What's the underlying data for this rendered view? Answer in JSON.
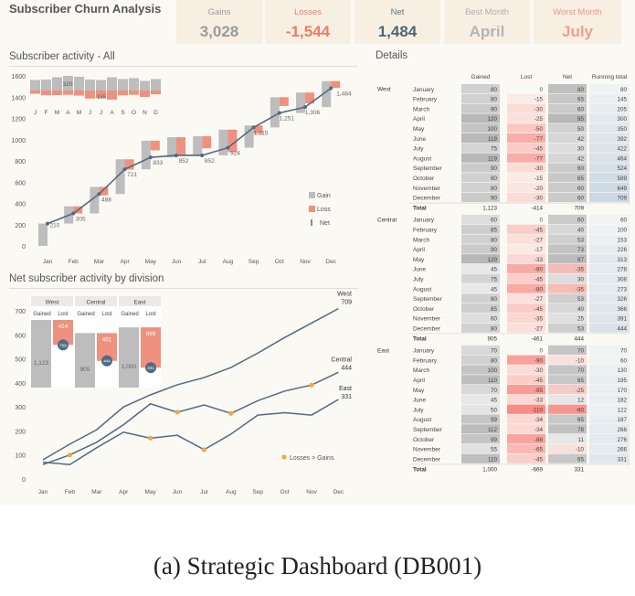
{
  "title": "Subscriber Churn Analysis",
  "kpis": [
    {
      "label": "Gains",
      "value": "3,028",
      "label_color": "#9b9b9b",
      "value_color": "#9a9a9a"
    },
    {
      "label": "Losses",
      "value": "-1,544",
      "label_color": "#e8826e",
      "value_color": "#ec7a64"
    },
    {
      "label": "Net",
      "value": "1,484",
      "label_color": "#5d7386",
      "value_color": "#4d6479"
    },
    {
      "label": "Best Month",
      "value": "April",
      "label_color": "#b0b0b0",
      "value_color": "#b5b5b5"
    },
    {
      "label": "Worst Month",
      "value": "July",
      "label_color": "#ee9585",
      "value_color": "#f0a08e"
    }
  ],
  "colors": {
    "gain": "#bdbdbd",
    "loss": "#f0907e",
    "net": "#4f6b82",
    "marker": "#f2a742"
  },
  "sections": {
    "activity": "Subscriber activity  - All",
    "division": "Net subscriber activity by division",
    "details": "Details"
  },
  "chart_data": [
    {
      "type": "bar",
      "title": "Subscriber activity  - All",
      "categories": [
        "Jan",
        "Feb",
        "Mar",
        "Apr",
        "May",
        "Jun",
        "Jul",
        "Aug",
        "Sep",
        "Oct",
        "Nov",
        "Dec"
      ],
      "ylim": [
        0,
        1600
      ],
      "yticks": [
        "0",
        "200",
        "400",
        "600",
        "800",
        "1000",
        "1200",
        "1400",
        "1600"
      ],
      "legend": [
        "Gain",
        "Loss",
        "Net"
      ],
      "series": [
        {
          "name": "Gain",
          "values": [
            210,
            162,
            250,
            327,
            269,
            190,
            180,
            242,
            209,
            284,
            192,
            245
          ]
        },
        {
          "name": "Loss",
          "values": [
            0,
            -67,
            -79,
            -97,
            -91,
            -177,
            -113,
            -211,
            -77,
            -82,
            -103,
            -64
          ]
        },
        {
          "name": "Net",
          "values": [
            210,
            305,
            488,
            721,
            833,
            852,
            852,
            924,
            1115,
            1251,
            1306,
            1484
          ]
        }
      ],
      "data_labels": [
        "210",
        "305",
        "488",
        "721",
        "833",
        "852",
        "852",
        "924",
        "1,115",
        "1,251",
        "1,306",
        "1,484"
      ],
      "inset": {
        "letters": [
          "J",
          "F",
          "M",
          "A",
          "M",
          "J",
          "J",
          "A",
          "S",
          "O",
          "N",
          "D"
        ],
        "gain_label": "320",
        "loss_label": "-155",
        "gains": [
          230,
          240,
          290,
          320,
          300,
          240,
          230,
          290,
          250,
          270,
          210,
          250
        ],
        "losses": [
          60,
          90,
          85,
          80,
          95,
          150,
          140,
          170,
          90,
          80,
          120,
          70
        ]
      }
    },
    {
      "type": "line",
      "title": "Net subscriber activity by division",
      "categories": [
        "Jan",
        "Feb",
        "Mar",
        "Apr",
        "May",
        "Jun",
        "Jul",
        "Aug",
        "Sep",
        "Oct",
        "Nov",
        "Dec"
      ],
      "ylim": [
        0,
        700
      ],
      "yticks": [
        "0",
        "100",
        "200",
        "300",
        "400",
        "500",
        "600",
        "700"
      ],
      "series": [
        {
          "name": "West",
          "values": [
            80,
            145,
            205,
            300,
            350,
            392,
            422,
            464,
            524,
            589,
            649,
            709
          ]
        },
        {
          "name": "Central",
          "values": [
            60,
            100,
            153,
            226,
            313,
            278,
            308,
            273,
            326,
            366,
            391,
            444
          ]
        },
        {
          "name": "East",
          "values": [
            70,
            60,
            130,
            195,
            170,
            182,
            122,
            187,
            266,
            276,
            266,
            331
          ]
        }
      ],
      "end_labels": [
        {
          "name": "West",
          "value": "709"
        },
        {
          "name": "Central",
          "value": "444"
        },
        {
          "name": "East",
          "value": "331"
        }
      ],
      "marker_points": [
        {
          "series": 1,
          "index": 1
        },
        {
          "series": 2,
          "index": 4
        },
        {
          "series": 1,
          "index": 5
        },
        {
          "series": 2,
          "index": 6
        },
        {
          "series": 1,
          "index": 7
        },
        {
          "series": 1,
          "index": 10
        }
      ],
      "marker_legend": "Losses > Gains",
      "inset": [
        {
          "name": "West",
          "gained": "1,123",
          "lost": "414",
          "net": "709",
          "g": 1123,
          "l": 414
        },
        {
          "name": "Central",
          "gained": "905",
          "lost": "461",
          "net": "444",
          "g": 905,
          "l": 461
        },
        {
          "name": "East",
          "gained": "1,000",
          "lost": "669",
          "net": "331",
          "g": 1000,
          "l": 669
        }
      ],
      "inset_sub": [
        "Gained",
        "Lost"
      ]
    },
    {
      "type": "table",
      "title": "Details",
      "columns": [
        "Gained",
        "Lost",
        "Net",
        "Running total"
      ],
      "months": [
        "January",
        "February",
        "March",
        "April",
        "May",
        "June",
        "July",
        "August",
        "September",
        "October",
        "November",
        "December"
      ],
      "total_label": "Total",
      "groups": [
        {
          "name": "West",
          "rows": [
            [
              80,
              0,
              80,
              80
            ],
            [
              80,
              -15,
              65,
              145
            ],
            [
              90,
              -30,
              60,
              205
            ],
            [
              120,
              -25,
              95,
              300
            ],
            [
              100,
              -50,
              50,
              350
            ],
            [
              119,
              -77,
              42,
              392
            ],
            [
              75,
              -45,
              30,
              422
            ],
            [
              119,
              -77,
              42,
              464
            ],
            [
              90,
              -30,
              60,
              524
            ],
            [
              80,
              -15,
              65,
              589
            ],
            [
              80,
              -20,
              60,
              649
            ],
            [
              90,
              -30,
              60,
              709
            ]
          ],
          "total": [
            "1,123",
            "-414",
            "709",
            ""
          ]
        },
        {
          "name": "Central",
          "rows": [
            [
              60,
              0,
              60,
              60
            ],
            [
              85,
              -45,
              40,
              100
            ],
            [
              80,
              -27,
              53,
              153
            ],
            [
              90,
              -17,
              73,
              226
            ],
            [
              120,
              -33,
              87,
              313
            ],
            [
              45,
              -80,
              -35,
              278
            ],
            [
              75,
              -45,
              30,
              308
            ],
            [
              45,
              -80,
              -35,
              273
            ],
            [
              80,
              -27,
              53,
              326
            ],
            [
              85,
              -45,
              40,
              366
            ],
            [
              60,
              -35,
              25,
              391
            ],
            [
              80,
              -27,
              53,
              444
            ]
          ],
          "total": [
            "905",
            "-461",
            "444",
            ""
          ]
        },
        {
          "name": "East",
          "rows": [
            [
              70,
              0,
              70,
              70
            ],
            [
              80,
              -90,
              -10,
              60
            ],
            [
              100,
              -30,
              70,
              130
            ],
            [
              110,
              -45,
              65,
              195
            ],
            [
              70,
              -95,
              -25,
              170
            ],
            [
              45,
              -33,
              12,
              182
            ],
            [
              50,
              -110,
              -60,
              122
            ],
            [
              99,
              -34,
              65,
              187
            ],
            [
              112,
              -34,
              78,
              266
            ],
            [
              99,
              -88,
              11,
              276
            ],
            [
              55,
              -65,
              -10,
              266
            ],
            [
              110,
              -45,
              65,
              331
            ]
          ],
          "total": [
            "1,000",
            "-669",
            "331",
            ""
          ]
        }
      ]
    }
  ],
  "caption": "(a) Strategic Dashboard (DB001)"
}
